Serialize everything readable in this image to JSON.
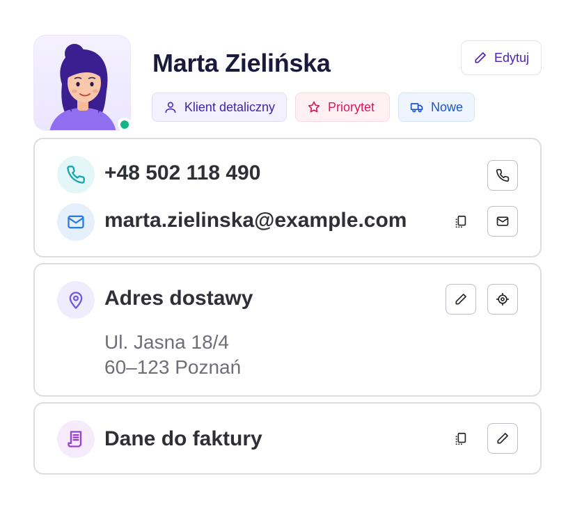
{
  "profile": {
    "name": "Marta Zielińska",
    "edit_label": "Edytuj",
    "status_color": "#15b48a",
    "tags": [
      {
        "label": "Klient detaliczny",
        "icon": "user-icon",
        "color": "#3f23a8"
      },
      {
        "label": "Priorytet",
        "icon": "star-icon",
        "color": "#d8185b"
      },
      {
        "label": "Nowe",
        "icon": "truck-icon",
        "color": "#1d53c8"
      }
    ]
  },
  "contact": {
    "phone": "+48 502 118 490",
    "email": "marta.zielinska@example.com"
  },
  "address": {
    "title": "Adres dostawy",
    "line1": "Ul. Jasna 18/4",
    "line2": "60–123 Poznań"
  },
  "invoice": {
    "title": "Dane do faktury"
  }
}
